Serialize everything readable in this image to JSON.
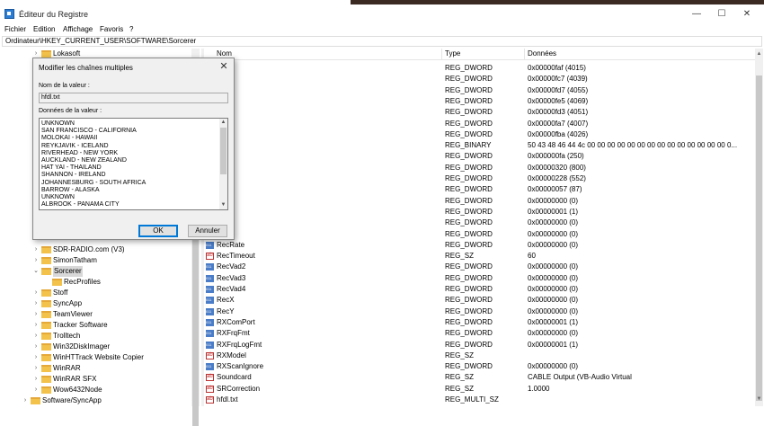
{
  "window": {
    "title": "Éditeur du Registre",
    "controls": {
      "minimize": "—",
      "maximize": "☐",
      "close": "✕"
    }
  },
  "menu": [
    "Fichier",
    "Edition",
    "Affichage",
    "Favoris",
    "?"
  ],
  "address": "Ordinateur\\HKEY_CURRENT_USER\\SOFTWARE\\Sorcerer",
  "tree": [
    {
      "label": "Lokasoft",
      "indent": 1,
      "chev": ">"
    },
    {
      "label": "SDR-RADIO.com (V3)",
      "indent": 1,
      "chev": ">"
    },
    {
      "label": "SimonTatham",
      "indent": 1,
      "chev": ">"
    },
    {
      "label": "Sorcerer",
      "indent": 1,
      "chev": "v",
      "selected": true
    },
    {
      "label": "RecProfiles",
      "indent": 2,
      "chev": ""
    },
    {
      "label": "Stoff",
      "indent": 1,
      "chev": ">"
    },
    {
      "label": "SyncApp",
      "indent": 1,
      "chev": ">"
    },
    {
      "label": "TeamViewer",
      "indent": 1,
      "chev": ">"
    },
    {
      "label": "Tracker Software",
      "indent": 1,
      "chev": ">"
    },
    {
      "label": "Trolltech",
      "indent": 1,
      "chev": ">"
    },
    {
      "label": "Win32DiskImager",
      "indent": 1,
      "chev": ">"
    },
    {
      "label": "WinHTTrack Website Copier",
      "indent": 1,
      "chev": ">"
    },
    {
      "label": "WinRAR",
      "indent": 1,
      "chev": ">"
    },
    {
      "label": "WinRAR SFX",
      "indent": 1,
      "chev": ">"
    },
    {
      "label": "Wow6432Node",
      "indent": 1,
      "chev": ">"
    },
    {
      "label": "Software/SyncApp",
      "indent": 0,
      "chev": ">"
    }
  ],
  "columns": {
    "name": "Nom",
    "type": "Type",
    "data": "Données"
  },
  "values": [
    {
      "name": "e",
      "type": "REG_DWORD",
      "data": "0x00000faf (4015)",
      "icon": "dword"
    },
    {
      "name": "",
      "type": "REG_DWORD",
      "data": "0x00000fc7 (4039)",
      "icon": "dword"
    },
    {
      "name": "s",
      "type": "REG_DWORD",
      "data": "0x00000fd7 (4055)",
      "icon": "dword"
    },
    {
      "name": "r",
      "type": "REG_DWORD",
      "data": "0x00000fe5 (4069)",
      "icon": "dword"
    },
    {
      "name": "d",
      "type": "REG_DWORD",
      "data": "0x00000fd3 (4051)",
      "icon": "dword"
    },
    {
      "name": "",
      "type": "REG_DWORD",
      "data": "0x00000fa7 (4007)",
      "icon": "dword"
    },
    {
      "name": "",
      "type": "REG_DWORD",
      "data": "0x00000fba (4026)",
      "icon": "dword"
    },
    {
      "name": "onf",
      "type": "REG_BINARY",
      "data": "50 43 48 46 44 4c 00 00 00 00 00 00 00 00 00 00 00 00 00 00 0...",
      "icon": "bin"
    },
    {
      "name": "H",
      "type": "REG_DWORD",
      "data": "0x000000fa (250)",
      "icon": "dword"
    },
    {
      "name": "W",
      "type": "REG_DWORD",
      "data": "0x00000320 (800)",
      "icon": "dword"
    },
    {
      "name": "X",
      "type": "REG_DWORD",
      "data": "0x00000228 (552)",
      "icon": "dword"
    },
    {
      "name": "Y",
      "type": "REG_DWORD",
      "data": "0x00000057 (87)",
      "icon": "dword"
    },
    {
      "name": "f2",
      "type": "REG_DWORD",
      "data": "0x00000000 (0)",
      "icon": "dword"
    },
    {
      "name": "f3",
      "type": "REG_DWORD",
      "data": "0x00000001 (1)",
      "icon": "dword"
    },
    {
      "name": "f4",
      "type": "REG_DWORD",
      "data": "0x00000000 (0)",
      "icon": "dword"
    },
    {
      "name": "gging",
      "type": "REG_DWORD",
      "data": "0x00000000 (0)",
      "icon": "dword"
    },
    {
      "name": "RecRate",
      "type": "REG_DWORD",
      "data": "0x00000000 (0)",
      "icon": "dword"
    },
    {
      "name": "RecTimeout",
      "type": "REG_SZ",
      "data": "60",
      "icon": "sz"
    },
    {
      "name": "RecVad2",
      "type": "REG_DWORD",
      "data": "0x00000000 (0)",
      "icon": "dword"
    },
    {
      "name": "RecVad3",
      "type": "REG_DWORD",
      "data": "0x00000000 (0)",
      "icon": "dword"
    },
    {
      "name": "RecVad4",
      "type": "REG_DWORD",
      "data": "0x00000000 (0)",
      "icon": "dword"
    },
    {
      "name": "RecX",
      "type": "REG_DWORD",
      "data": "0x00000000 (0)",
      "icon": "dword"
    },
    {
      "name": "RecY",
      "type": "REG_DWORD",
      "data": "0x00000000 (0)",
      "icon": "dword"
    },
    {
      "name": "RXComPort",
      "type": "REG_DWORD",
      "data": "0x00000001 (1)",
      "icon": "dword"
    },
    {
      "name": "RXFrqFmt",
      "type": "REG_DWORD",
      "data": "0x00000000 (0)",
      "icon": "dword"
    },
    {
      "name": "RXFrqLogFmt",
      "type": "REG_DWORD",
      "data": "0x00000001 (1)",
      "icon": "dword"
    },
    {
      "name": "RXModel",
      "type": "REG_SZ",
      "data": "",
      "icon": "sz"
    },
    {
      "name": "RXScanIgnore",
      "type": "REG_DWORD",
      "data": "0x00000000 (0)",
      "icon": "dword"
    },
    {
      "name": "Soundcard",
      "type": "REG_SZ",
      "data": "CABLE Output (VB-Audio Virtual",
      "icon": "sz"
    },
    {
      "name": "SRCorrection",
      "type": "REG_SZ",
      "data": "1.0000",
      "icon": "sz"
    },
    {
      "name": "hfdl.txt",
      "type": "REG_MULTI_SZ",
      "data": "",
      "icon": "sz"
    }
  ],
  "dialog": {
    "title": "Modifier les chaînes multiples",
    "close": "✕",
    "name_label": "Nom de la valeur :",
    "name_value": "hfdl.txt",
    "data_label": "Données de la valeur :",
    "lines": [
      "UNKNOWN",
      "SAN FRANCISCO - CALIFORNIA",
      "MOLOKAI - HAWAII",
      "REYKJAVIK - ICELAND",
      "RIVERHEAD - NEW YORK",
      "AUCKLAND - NEW ZEALAND",
      "HAT YAI - THAILAND",
      "SHANNON - IRELAND",
      "JOHANNESBURG - SOUTH AFRICA",
      "BARROW - ALASKA",
      "UNKNOWN",
      "ALBROOK - PANAMA CITY"
    ],
    "ok": "OK",
    "cancel": "Annuler"
  }
}
